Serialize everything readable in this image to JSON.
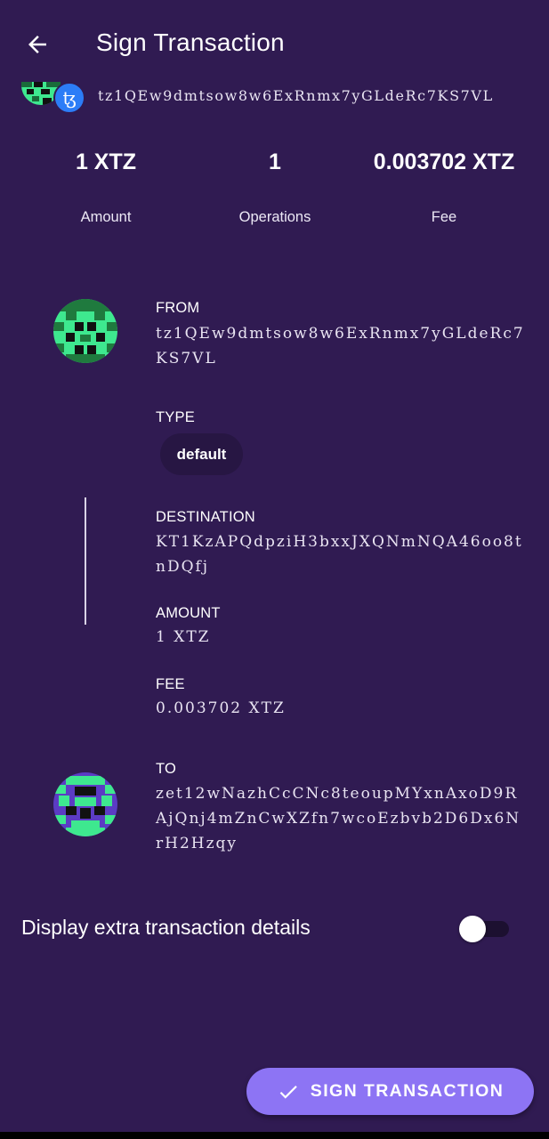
{
  "header": {
    "back_icon": "arrow-left-icon",
    "title": "Sign Transaction"
  },
  "account": {
    "badge_icon": "tezos-icon",
    "badge_glyph": "ꜩ",
    "badge_color": "#2c7df7",
    "address": "tz1QEw9dmtsow8w6ExRnmx7yGLdeRc7KS7VL"
  },
  "stats": [
    {
      "value": "1 XTZ",
      "label": "Amount"
    },
    {
      "value": "1",
      "label": "Operations"
    },
    {
      "value": "0.003702 XTZ",
      "label": "Fee"
    }
  ],
  "from": {
    "label": "FROM",
    "address": "tz1QEw9dmtsow8w6ExRnmx7yGLdeRc7KS7VL"
  },
  "type": {
    "label": "TYPE",
    "value": "default"
  },
  "operation": {
    "destination_label": "DESTINATION",
    "destination": "KT1KzAPQdpziH3bxxJXQNmNQA46oo8tnDQfj",
    "amount_label": "AMOUNT",
    "amount": "1 XTZ",
    "fee_label": "FEE",
    "fee": "0.003702 XTZ"
  },
  "to": {
    "label": "TO",
    "address": "zet12wNazhCcCNc8teoupMYxnAxoD9RAjQnj4mZnCwXZfn7wcoEzbvb2D6Dx6NrH2Hzqy"
  },
  "extra_details": {
    "label": "Display extra transaction details",
    "enabled": false
  },
  "sign_button": {
    "icon": "check-icon",
    "label": "SIGN TRANSACTION",
    "color": "#8d74f4"
  },
  "colors": {
    "background": "#301b52",
    "avatar_green": "#3ee88f",
    "avatar_purple": "#5b3cc4"
  }
}
